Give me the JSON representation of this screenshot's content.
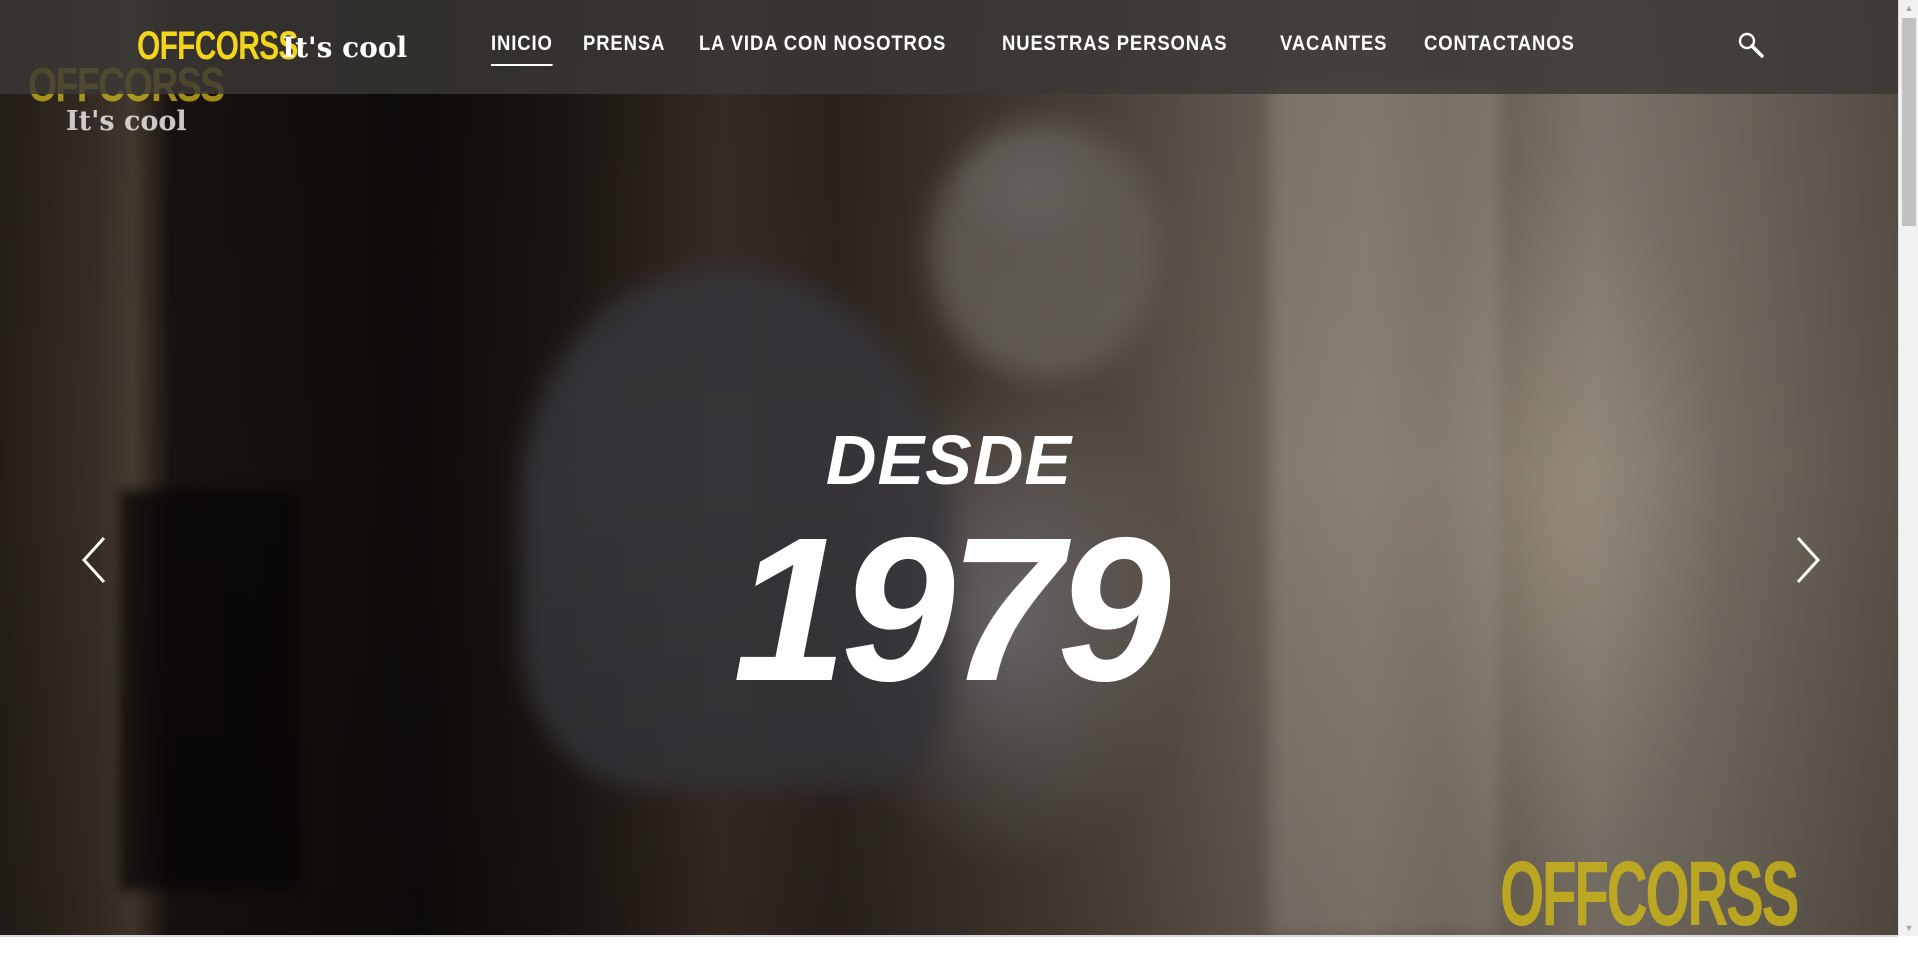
{
  "header": {
    "logo_brand": "OFFCORSS",
    "logo_registered": "®",
    "logo_tagline": "It's cool",
    "nav": [
      {
        "label": "INICIO",
        "active": true
      },
      {
        "label": "PRENSA",
        "active": false
      },
      {
        "label": "LA VIDA CON NOSOTROS",
        "active": false
      },
      {
        "label": "NUESTRAS PERSONAS",
        "active": false
      },
      {
        "label": "VACANTES",
        "active": false
      },
      {
        "label": "CONTACTANOS",
        "active": false
      }
    ],
    "search_icon": "search-icon"
  },
  "hero": {
    "headline_small": "DESDE",
    "headline_big": "1979",
    "watermark_brand": "OFFCORSS",
    "watermark_tagline": "It's cool",
    "corner_brand": "OFFCORSS",
    "prev_icon": "chevron-left-icon",
    "next_icon": "chevron-right-icon"
  },
  "colors": {
    "brand_yellow": "#f2d51a",
    "nav_bg": "#3a3836",
    "text_white": "#ffffff"
  }
}
